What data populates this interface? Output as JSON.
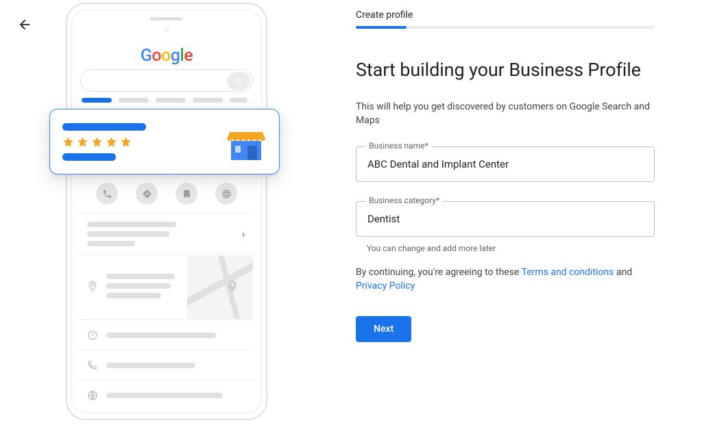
{
  "step": {
    "label": "Create profile"
  },
  "heading": "Start building your Business Profile",
  "subheading": "This will help you get discovered by customers on Google Search and Maps",
  "fields": {
    "business_name": {
      "label": "Business name*",
      "value": "ABC Dental and Implant Center"
    },
    "business_category": {
      "label": "Business category*",
      "value": "Dentist",
      "hint": "You can change and add more later"
    }
  },
  "terms": {
    "prefix": "By continuing, you're agreeing to these ",
    "terms_link": "Terms and conditions",
    "mid": " and ",
    "privacy_link": "Privacy Policy"
  },
  "next_button": "Next",
  "illustration": {
    "logo_letters": [
      "G",
      "o",
      "o",
      "g",
      "l",
      "e"
    ],
    "rating_stars": 5
  }
}
